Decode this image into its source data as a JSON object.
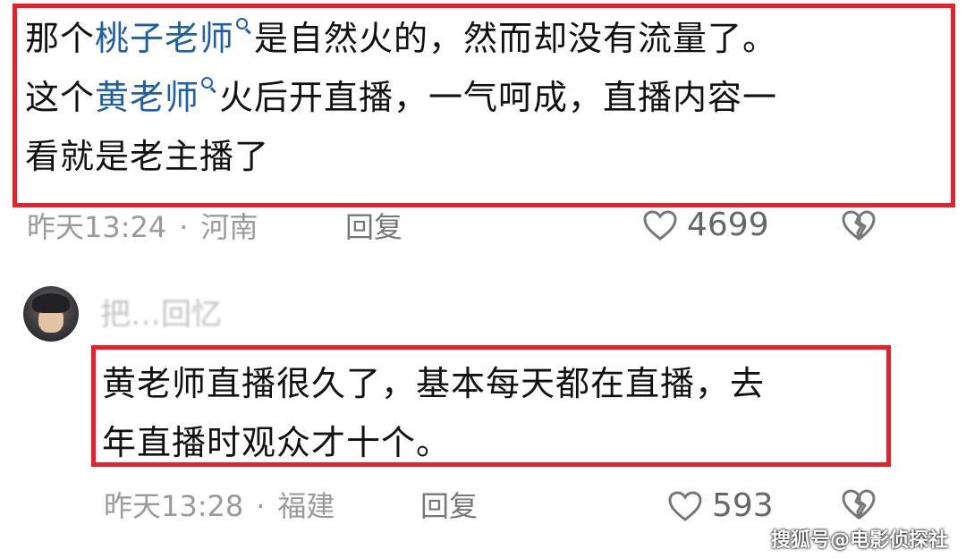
{
  "comment1": {
    "line1_prefix": "那个",
    "line1_link": "桃子老师",
    "line1_suffix": "是自然火的，然而却没有流量了。",
    "line2_prefix": "这个",
    "line2_link": "黄老师",
    "line2_suffix": "火后开直播，一气呵成，直播内容一",
    "line3": "看就是老主播了",
    "time": "昨天13:24",
    "separator": "·",
    "location": "河南",
    "reply_label": "回复",
    "likes": "4699"
  },
  "comment2": {
    "username": "把…回忆",
    "line1": "黄老师直播很久了，基本每天都在直播，去",
    "line2": "年直播时观众才十个。",
    "time": "昨天13:28",
    "separator": "·",
    "location": "福建",
    "reply_label": "回复",
    "likes": "593"
  },
  "watermark": "搜狐号@电影侦探社",
  "colors": {
    "highlight_border": "#e8202b",
    "link": "#1f5fa6",
    "meta_text": "#9a9a9a"
  },
  "icons": [
    "search-icon",
    "heart-icon",
    "broken-heart-icon"
  ]
}
